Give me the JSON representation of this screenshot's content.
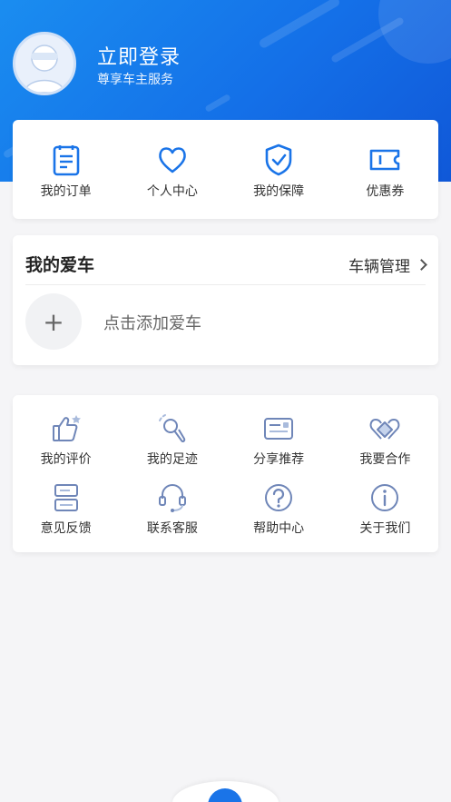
{
  "profile": {
    "login_title": "立即登录",
    "login_sub": "尊享车主服务"
  },
  "quick_actions": [
    {
      "label": "我的订单",
      "icon": "order-icon"
    },
    {
      "label": "个人中心",
      "icon": "heart-icon"
    },
    {
      "label": "我的保障",
      "icon": "shield-icon"
    },
    {
      "label": "优惠券",
      "icon": "coupon-icon"
    }
  ],
  "car": {
    "title": "我的爱车",
    "manage_label": "车辆管理",
    "add_label": "点击添加爱车",
    "add_symbol": "+"
  },
  "services": [
    {
      "label": "我的评价",
      "icon": "thumbs-up-icon"
    },
    {
      "label": "我的足迹",
      "icon": "footprint-icon"
    },
    {
      "label": "分享推荐",
      "icon": "share-card-icon"
    },
    {
      "label": "我要合作",
      "icon": "cooperation-icon"
    },
    {
      "label": "意见反馈",
      "icon": "feedback-icon"
    },
    {
      "label": "联系客服",
      "icon": "headset-icon"
    },
    {
      "label": "帮助中心",
      "icon": "help-icon"
    },
    {
      "label": "关于我们",
      "icon": "info-icon"
    }
  ],
  "colors": {
    "brand": "#1470e8",
    "icon_blue": "#1a74e8",
    "icon_muted": "#6f86b8"
  }
}
